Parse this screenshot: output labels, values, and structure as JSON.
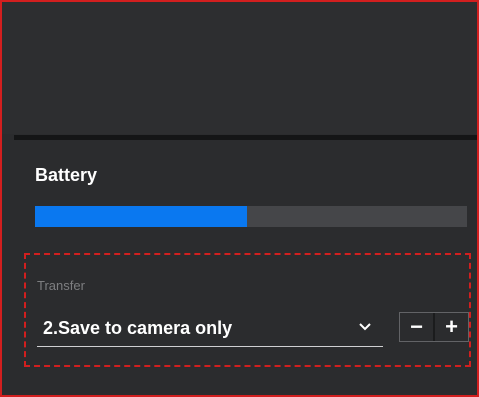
{
  "battery": {
    "label": "Battery",
    "level_fraction": 0.49,
    "fill_color": "#0a78f0"
  },
  "transfer": {
    "label": "Transfer",
    "selected_option": "2.Save to camera only",
    "stepper": {
      "minus_label": "−",
      "plus_label": "+"
    }
  },
  "icons": {
    "dropdown": "chevron-down-icon"
  },
  "colors": {
    "panel_background": "#2b2c2e",
    "highlight_border": "#d21f1f"
  }
}
